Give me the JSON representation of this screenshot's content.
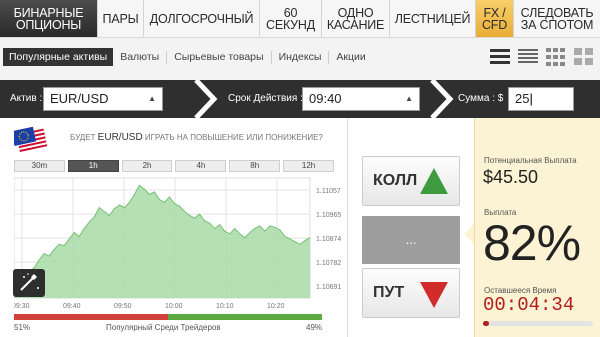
{
  "topnav": {
    "tabs": [
      {
        "label": "БИНАРНЫЕ ОПЦИОНЫ",
        "width": 98
      },
      {
        "label": "ПАРЫ",
        "width": 46
      },
      {
        "label": "ДОЛГОСРОЧНЫЙ",
        "width": 116
      },
      {
        "label": "60 СЕКУНД",
        "width": 62
      },
      {
        "label": "ОДНО КАСАНИЕ",
        "width": 68
      },
      {
        "label": "ЛЕСТНИЦЕЙ",
        "width": 86
      },
      {
        "label": "FX / CFD",
        "width": 38
      },
      {
        "label": "СЛЕДОВАТЬ ЗА СПОТОМ",
        "width": 86
      }
    ]
  },
  "subnav": {
    "items": [
      "Популярные активы",
      "Валюты",
      "Сырьевые товары",
      "Индексы",
      "Акции"
    ]
  },
  "selection": {
    "asset_label": "Актив :",
    "asset_value": "EUR/USD",
    "expiry_label": "Срок Действия :",
    "expiry_value": "09:40",
    "amount_label": "Сумма : $",
    "amount_value": "25"
  },
  "question": {
    "prefix": "БУДЕТ",
    "asset": "EUR/USD",
    "suffix": "ИГРАТЬ НА ПОВЫШЕНИЕ ИЛИ ПОНИЖЕНИЕ?"
  },
  "timeframes": [
    "30m",
    "1h",
    "2h",
    "4h",
    "8h",
    "12h"
  ],
  "chart_data": {
    "type": "area",
    "x_ticks": [
      "09:30",
      "09:40",
      "09:50",
      "10:00",
      "10:10",
      "10:20"
    ],
    "y_ticks": [
      "1.11057",
      "1.10965",
      "1.10874",
      "1.10782",
      "1.10691"
    ],
    "ylim": [
      1.10645,
      1.11103
    ],
    "x": [
      0,
      1,
      2,
      3,
      4,
      5,
      6,
      7,
      8,
      9,
      10,
      11,
      12,
      13,
      14,
      15,
      16,
      17,
      18,
      19,
      20,
      21,
      22,
      23,
      24,
      25,
      26,
      27,
      28,
      29,
      30,
      31,
      32,
      33,
      34,
      35,
      36,
      37,
      38,
      39,
      40,
      41,
      42,
      43,
      44,
      45,
      46,
      47,
      48,
      49,
      50,
      51,
      52,
      53,
      54,
      55,
      56,
      57,
      58,
      59
    ],
    "values": [
      1.10705,
      1.10718,
      1.1073,
      1.10745,
      1.1076,
      1.1079,
      1.10815,
      1.10805,
      1.1083,
      1.1085,
      1.10845,
      1.1087,
      1.10895,
      1.1088,
      1.1091,
      1.10935,
      1.10955,
      1.1099,
      1.10975,
      1.1096,
      1.10985,
      1.11,
      1.1099,
      1.1101,
      1.1104,
      1.11075,
      1.1106,
      1.1104,
      1.1105,
      1.1102,
      1.1101,
      1.1103,
      1.11005,
      1.10995,
      1.10975,
      1.1096,
      1.1095,
      1.10965,
      1.1094,
      1.1093,
      1.1091,
      1.10925,
      1.109,
      1.1089,
      1.1091,
      1.1089,
      1.10875,
      1.10895,
      1.1091,
      1.1092,
      1.109,
      1.1092,
      1.10915,
      1.10905,
      1.1088,
      1.1087,
      1.1086,
      1.1085,
      1.10865,
      1.10875
    ],
    "fill_color": "#a8dba6",
    "line_color": "#77c075",
    "grid": true
  },
  "sentiment": {
    "left_pct": "51%",
    "right_pct": "49%",
    "label": "Популярный Среди Трейдеров",
    "left_color": "#d0413b",
    "right_color": "#5cab42"
  },
  "buttons": {
    "call_label": "КОЛЛ",
    "middle_label": "...",
    "put_label": "ПУТ",
    "up_color": "#3f9b3f",
    "down_color": "#d12b2b"
  },
  "payout": {
    "potential_label": "Потенциальная Выплата",
    "potential_value": "$45.50",
    "payout_label": "Выплата",
    "payout_value": "82%",
    "remaining_label": "Оставшееся Время",
    "remaining_value": "00:04:34",
    "remaining_progress": 0.05
  }
}
